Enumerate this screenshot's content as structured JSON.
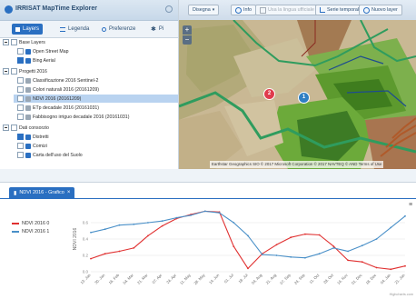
{
  "app": {
    "title": "IRRISAT MapTime Explorer"
  },
  "left_tabs": [
    {
      "label": "Layers",
      "icon": "layers-icon",
      "active": true
    },
    {
      "label": "Legenda",
      "icon": "list-icon",
      "active": false
    },
    {
      "label": "Preferenze",
      "icon": "gear-icon",
      "active": false
    },
    {
      "label": "Pi",
      "icon": "plugin-icon",
      "active": false
    }
  ],
  "tree": {
    "base_layers": {
      "label": "Base Layers",
      "items": [
        {
          "label": "Open Street Map",
          "checked": false
        },
        {
          "label": "Bing Aerial",
          "checked": true
        }
      ]
    },
    "progetti": {
      "label": "Progetti 2016",
      "items": [
        {
          "label": "Classificazione 2016 Sentinel-2",
          "checked": false
        },
        {
          "label": "Colori naturali 2016 (20161209)",
          "checked": false
        },
        {
          "label": "NDVI 2016 (20161209)",
          "checked": false
        },
        {
          "label": "ETp decadale 2016 (20161031)",
          "checked": false
        },
        {
          "label": "Fabbisogno irriguo decadale 2016 (20161031)",
          "checked": false
        }
      ]
    },
    "consorzio": {
      "label": "Dati consorzio",
      "items": [
        {
          "label": "Distretti",
          "checked": true
        },
        {
          "label": "Comizi",
          "checked": false
        },
        {
          "label": "Carta dell'uso del Suolo",
          "checked": false
        }
      ]
    }
  },
  "map_toolbar": {
    "buttons": [
      {
        "label": "Disegna",
        "disabled": false
      },
      {
        "label": "Info",
        "disabled": false
      },
      {
        "label": "Usa la lingua ufficiale",
        "disabled": true
      },
      {
        "label": "Serie temporale",
        "disabled": false
      },
      {
        "label": "Nuovo layer",
        "disabled": false
      }
    ]
  },
  "map": {
    "markers": [
      {
        "label": "1"
      },
      {
        "label": "2"
      }
    ],
    "attribution": "Earthstar Geographics SIO © 2017 Microsoft Corporation © 2017 NAVTEQ © AND Terms of Use",
    "zoom_in": "+",
    "zoom_out": "−"
  },
  "chart_panel": {
    "tab_label": "NDVI 2016 - Grafico"
  },
  "chart_data": {
    "type": "line",
    "series": [
      {
        "name": "NDVI 2016 0",
        "color": "#e03030",
        "values": [
          0.16,
          0.22,
          0.25,
          0.29,
          0.44,
          0.56,
          0.65,
          0.7,
          0.74,
          0.73,
          0.31,
          0.04,
          0.22,
          0.33,
          0.42,
          0.46,
          0.45,
          0.31,
          0.14,
          0.12,
          0.05,
          0.03,
          0.07
        ]
      },
      {
        "name": "NDVI 2016 1",
        "color": "#4a90c8",
        "values": [
          0.48,
          0.52,
          0.57,
          0.58,
          0.6,
          0.62,
          0.66,
          0.69,
          0.74,
          0.72,
          0.6,
          0.44,
          0.21,
          0.2,
          0.18,
          0.17,
          0.22,
          0.29,
          0.25,
          0.32,
          0.4,
          0.54,
          0.68
        ]
      }
    ],
    "categories": [
      "13. Jan",
      "30. Jan",
      "16. Feb",
      "04. Mar",
      "21. Mar",
      "07. Apr",
      "24. Apr",
      "11. May",
      "28. May",
      "14. Jun",
      "01. Jul",
      "18. Jul",
      "04. Aug",
      "21. Aug",
      "07. Sep",
      "24. Sep",
      "11. Oct",
      "28. Oct",
      "14. Nov",
      "01. Dec",
      "18. Dec",
      "04. Jan",
      "21. Jan"
    ],
    "yticks": [
      "0.6",
      "0.4",
      "0.2",
      "0.0"
    ],
    "ylim": [
      0,
      0.8
    ],
    "ylabel": "NDVI 2016",
    "credit": "Highcharts.com"
  }
}
